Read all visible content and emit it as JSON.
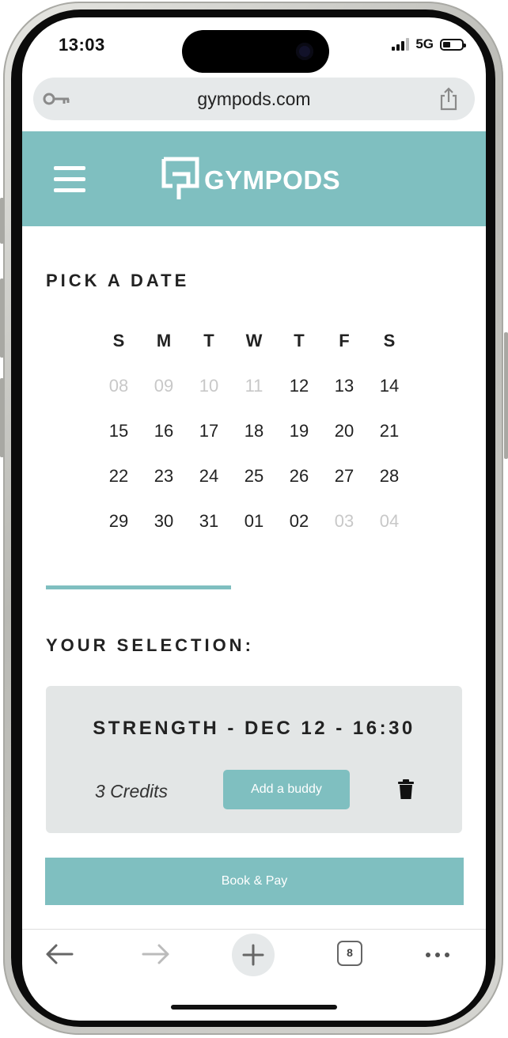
{
  "status_bar": {
    "time": "13:03",
    "network": "5G"
  },
  "browser": {
    "url": "gympods.com",
    "open_tabs": "8"
  },
  "header": {
    "logo_text": "GYMPODS"
  },
  "calendar": {
    "title": "PICK A DATE",
    "weekdays": [
      "S",
      "M",
      "T",
      "W",
      "T",
      "F",
      "S"
    ],
    "weeks": [
      [
        {
          "d": "08",
          "muted": true
        },
        {
          "d": "09",
          "muted": true
        },
        {
          "d": "10",
          "muted": true
        },
        {
          "d": "11",
          "muted": true
        },
        {
          "d": "12",
          "muted": false
        },
        {
          "d": "13",
          "muted": false
        },
        {
          "d": "14",
          "muted": false
        }
      ],
      [
        {
          "d": "15",
          "muted": false
        },
        {
          "d": "16",
          "muted": false
        },
        {
          "d": "17",
          "muted": false
        },
        {
          "d": "18",
          "muted": false
        },
        {
          "d": "19",
          "muted": false
        },
        {
          "d": "20",
          "muted": false
        },
        {
          "d": "21",
          "muted": false
        }
      ],
      [
        {
          "d": "22",
          "muted": false
        },
        {
          "d": "23",
          "muted": false
        },
        {
          "d": "24",
          "muted": false
        },
        {
          "d": "25",
          "muted": false
        },
        {
          "d": "26",
          "muted": false
        },
        {
          "d": "27",
          "muted": false
        },
        {
          "d": "28",
          "muted": false
        }
      ],
      [
        {
          "d": "29",
          "muted": false
        },
        {
          "d": "30",
          "muted": false
        },
        {
          "d": "31",
          "muted": false
        },
        {
          "d": "01",
          "muted": false
        },
        {
          "d": "02",
          "muted": false
        },
        {
          "d": "03",
          "muted": true
        },
        {
          "d": "04",
          "muted": true
        }
      ]
    ]
  },
  "selection": {
    "title": "YOUR SELECTION:",
    "item": "STRENGTH - DEC 12 - 16:30",
    "credits": "3 Credits",
    "buddy_label": "Add a buddy"
  },
  "book_label": "Book & Pay",
  "colors": {
    "accent": "#7fbfc0",
    "card_bg": "#e3e6e6",
    "muted_date": "#c8c8c8"
  },
  "icons": [
    "key-icon",
    "share-icon",
    "hamburger-icon",
    "gympods-logo-icon",
    "trash-icon",
    "back-arrow-icon",
    "forward-arrow-icon",
    "plus-icon",
    "tabs-icon",
    "more-icon"
  ]
}
